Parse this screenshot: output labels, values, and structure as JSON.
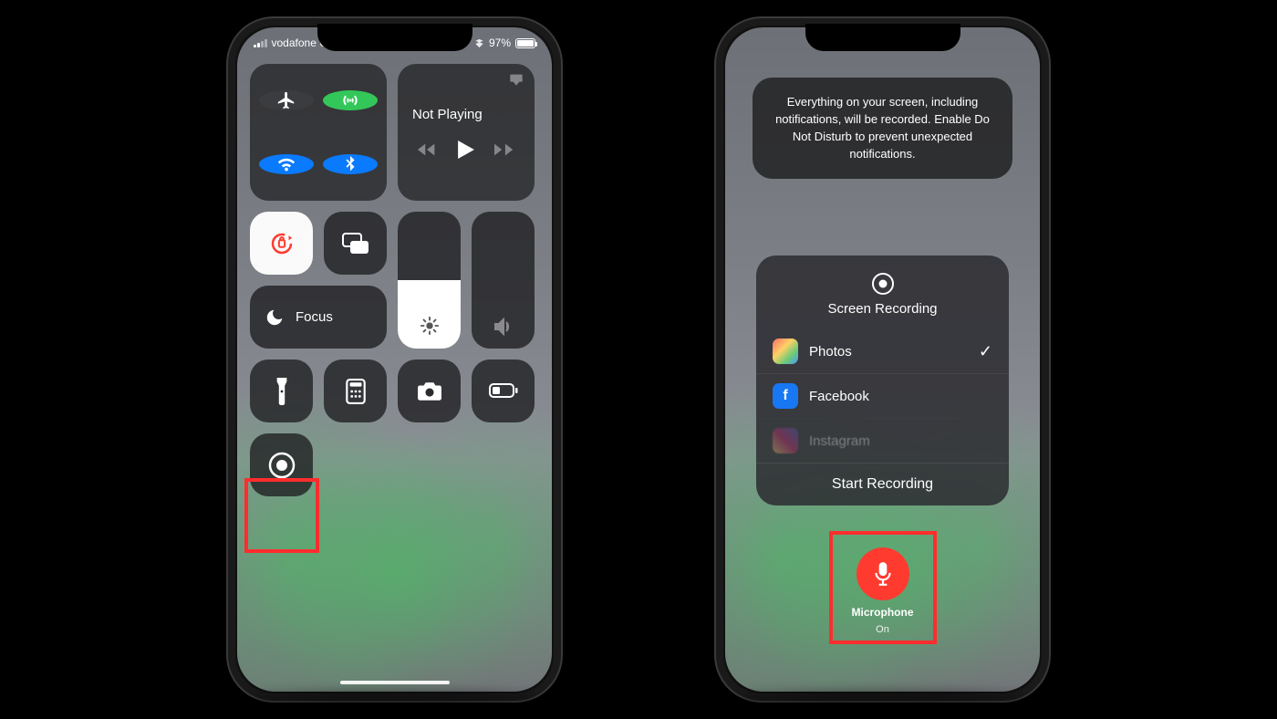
{
  "status": {
    "carrier": "vodafone UK",
    "battery_pct": "97%"
  },
  "phone1": {
    "media_title": "Not Playing",
    "focus_label": "Focus"
  },
  "phone2": {
    "info_text": "Everything on your screen, including notifications, will be recorded. Enable Do Not Disturb to prevent unexpected notifications.",
    "sheet_title": "Screen Recording",
    "apps": [
      {
        "name": "Photos",
        "selected": true
      },
      {
        "name": "Facebook",
        "selected": false
      },
      {
        "name": "Instagram",
        "selected": false
      }
    ],
    "action": "Start Recording",
    "mic_label": "Microphone",
    "mic_state": "On"
  },
  "colors": {
    "highlight": "#ff2d2d",
    "green": "#33c759",
    "blue": "#0a7aff",
    "red": "#ff3b30"
  }
}
